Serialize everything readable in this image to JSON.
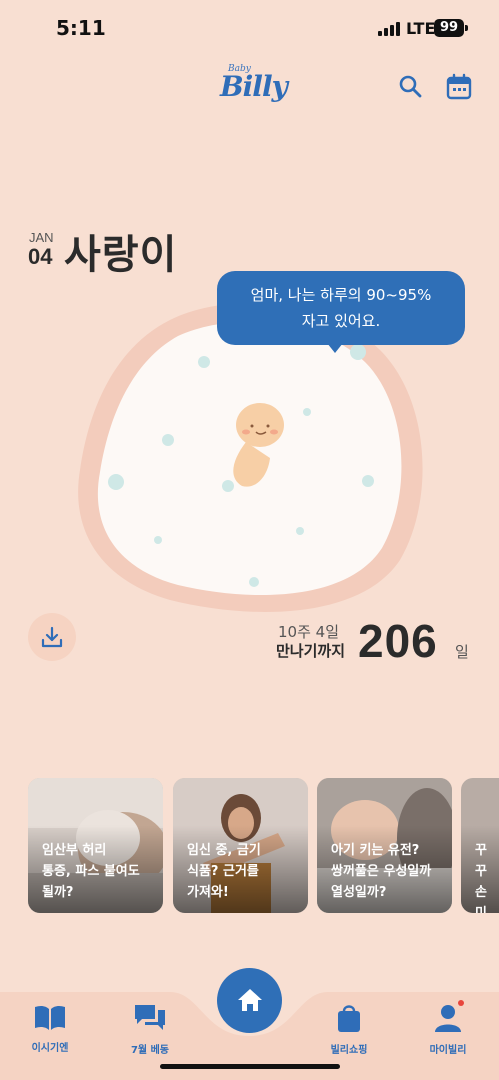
{
  "status_bar": {
    "time": "5:11",
    "network": "LTE",
    "battery": "99"
  },
  "header": {
    "logo_small": "Baby",
    "logo_main": "Billy"
  },
  "date": {
    "month": "JAN",
    "day": "04"
  },
  "baby": {
    "name": "사랑이"
  },
  "speech_bubble": {
    "line1": "엄마, 나는 하루의 90~95%",
    "line2": "자고 있어요."
  },
  "countdown": {
    "week": "10주 4일",
    "label": "만나기까지",
    "days": "206",
    "unit": "일"
  },
  "cards": [
    {
      "text": "임산부 허리\n통증, 파스 붙여도\n될까?"
    },
    {
      "text": "임신 중, 금기\n식품? 근거를\n가져와!"
    },
    {
      "text": "아기 키는 유전?\n쌍꺼풀은 우성일까\n열성일까?"
    },
    {
      "text": "꾸꾸\n손미"
    }
  ],
  "nav": {
    "items": [
      {
        "label": "이시기엔",
        "icon": "book-icon"
      },
      {
        "label": "7월 베동",
        "icon": "chat-icon"
      },
      {
        "label": "",
        "icon": "home-icon"
      },
      {
        "label": "빌리쇼핑",
        "icon": "shopping-bag-icon"
      },
      {
        "label": "마이빌리",
        "icon": "person-icon"
      }
    ]
  },
  "colors": {
    "background": "#f8dfd2",
    "accent": "#2f6fb7",
    "notification": "#e8453c"
  }
}
